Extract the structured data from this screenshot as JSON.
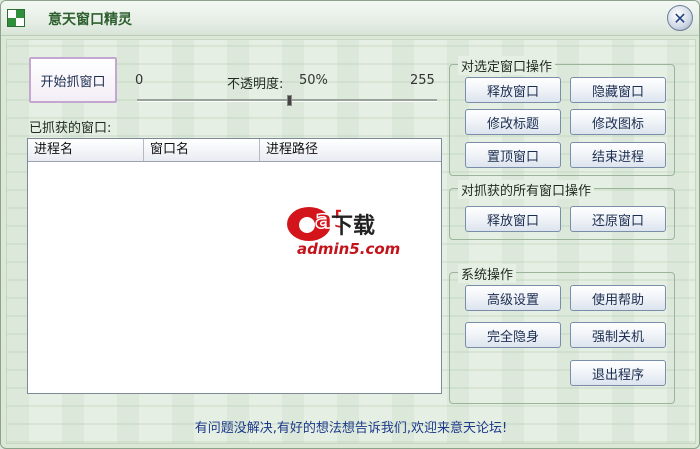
{
  "window": {
    "title": "意天窗口精灵",
    "close_label": "✕"
  },
  "grab": {
    "button_label": "开始抓窗口",
    "min_value": "0",
    "opacity_label": "不透明度:",
    "opacity_value": "50%",
    "max_value": "255",
    "opacity_level": 0.5
  },
  "captured": {
    "label": "已抓获的窗口:",
    "columns": [
      "进程名",
      "窗口名",
      "进程路径"
    ],
    "rows": []
  },
  "selected_ops": {
    "title": "对选定窗口操作",
    "buttons": [
      "释放窗口",
      "隐藏窗口",
      "修改标题",
      "修改图标",
      "置顶窗口",
      "结束进程"
    ]
  },
  "all_ops": {
    "title": "对抓获的所有窗口操作",
    "buttons": [
      "释放窗口",
      "还原窗口"
    ]
  },
  "system_ops": {
    "title": "系统操作",
    "buttons": [
      "高级设置",
      "使用帮助",
      "完全隐身",
      "强制关机",
      "退出程序"
    ]
  },
  "footer": {
    "text": "有问题没解决,有好的想法想告诉我们,欢迎来意天论坛!"
  },
  "watermark": {
    "brand": "a5",
    "text": "下载",
    "url": "admin5.com"
  },
  "colors": {
    "accent_green": "#2e5f2e",
    "link_blue": "#1c3a8a",
    "watermark_red": "#c4141b"
  }
}
